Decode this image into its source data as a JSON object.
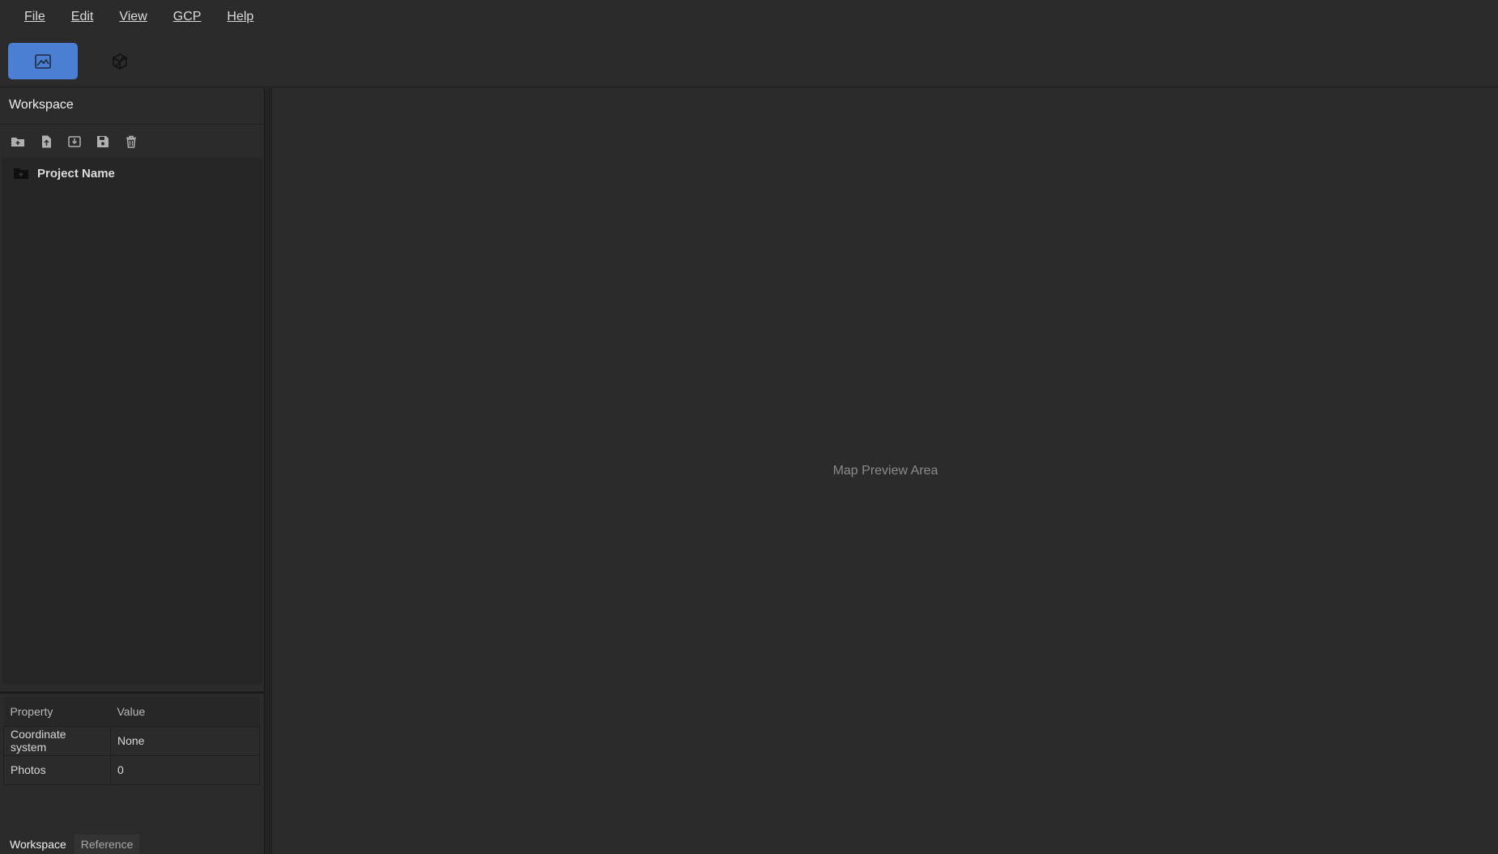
{
  "menu": {
    "items": [
      {
        "label": "File"
      },
      {
        "label": "Edit"
      },
      {
        "label": "View"
      },
      {
        "label": "GCP"
      },
      {
        "label": "Help"
      }
    ]
  },
  "toolbar": {
    "modes": [
      {
        "icon": "image-icon",
        "active": true
      },
      {
        "icon": "cube-icon",
        "active": false
      }
    ],
    "accent_color": "#4a7fd4"
  },
  "workspace": {
    "title": "Workspace",
    "tools": [
      "add-folder-icon",
      "import-file-icon",
      "import-icon",
      "save-icon",
      "delete-icon"
    ],
    "tree": {
      "project_name": "Project Name"
    }
  },
  "properties": {
    "headers": {
      "property": "Property",
      "value": "Value"
    },
    "rows": [
      {
        "property": "Coordinate system",
        "value": "None"
      },
      {
        "property": "Photos",
        "value": "0"
      }
    ]
  },
  "bottom_tabs": [
    {
      "label": "Workspace",
      "active": true
    },
    {
      "label": "Reference",
      "active": false
    }
  ],
  "map": {
    "placeholder": "Map Preview Area"
  }
}
